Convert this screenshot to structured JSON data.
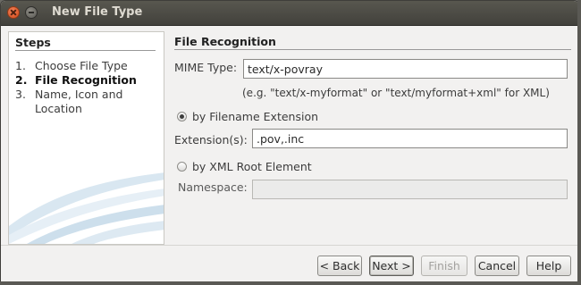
{
  "window": {
    "title": "New File Type"
  },
  "steps": {
    "header": "Steps",
    "items": [
      {
        "num": "1.",
        "label": "Choose File Type"
      },
      {
        "num": "2.",
        "label": "File Recognition"
      },
      {
        "num": "3.",
        "label": "Name, Icon and Location"
      }
    ]
  },
  "recognition": {
    "header": "File Recognition",
    "mime_label": "MIME Type:",
    "mime_value": "text/x-povray",
    "mime_hint": "(e.g. \"text/x-myformat\" or \"text/myformat+xml\" for XML)",
    "by_extension_label": "by Filename Extension",
    "extensions_label": "Extension(s):",
    "extensions_value": ".pov,.inc",
    "by_xml_label": "by XML Root Element",
    "namespace_label": "Namespace:",
    "namespace_value": ""
  },
  "buttons": {
    "back": "< Back",
    "next": "Next >",
    "finish": "Finish",
    "cancel": "Cancel",
    "help": "Help"
  }
}
